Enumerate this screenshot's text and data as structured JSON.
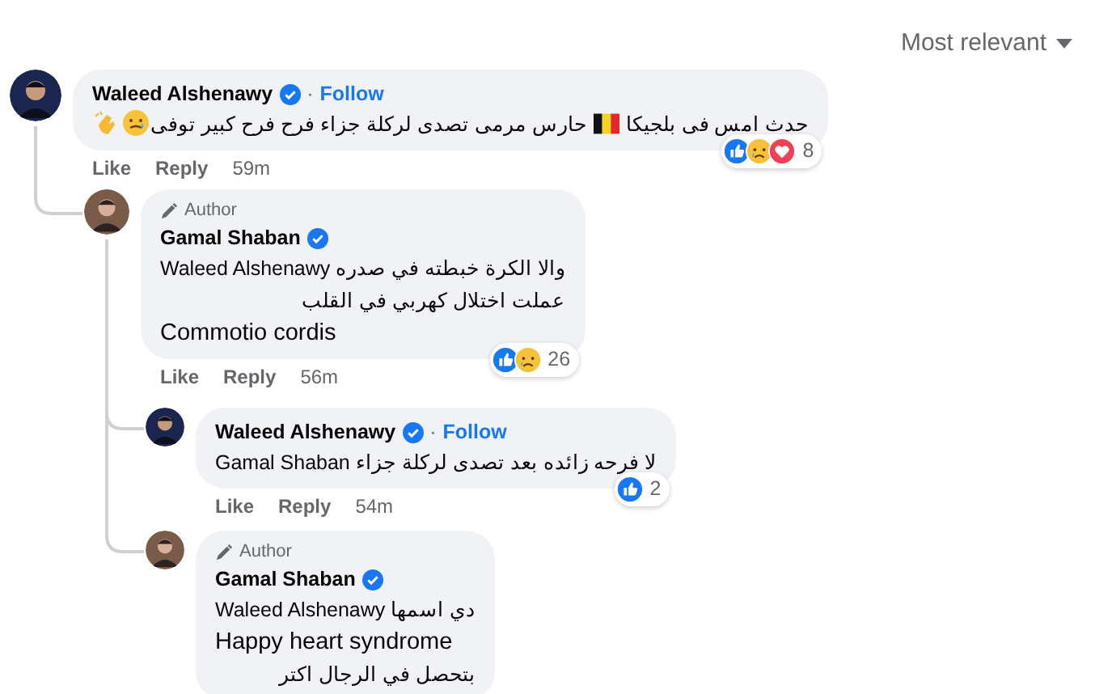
{
  "sort": {
    "label": "Most relevant"
  },
  "comments": [
    {
      "name": "Waleed Alshenawy",
      "verified": true,
      "separator": "·",
      "follow": "Follow",
      "lines": [
        [
          {
            "kind": "text",
            "text": "حدث امس فى بلجيكا"
          },
          {
            "kind": "flag-be"
          },
          {
            "kind": "text",
            "text": "حارس مرمى تصدى لركلة جزاء فرح فرح كبير توفى"
          },
          {
            "kind": "tear-smile"
          },
          {
            "kind": "clap"
          }
        ]
      ],
      "actions": [
        "Like",
        "Reply"
      ],
      "time": "59m",
      "reactions": [
        {
          "kind": "like"
        },
        {
          "kind": "sad"
        },
        {
          "kind": "love"
        }
      ],
      "reaction_count": "8",
      "children": [
        {
          "badge": "Author",
          "name": "Gamal Shaban",
          "verified": true,
          "lines": [
            [
              {
                "kind": "text",
                "text": "والا الكرة خبطته في صدره Waleed Alshenawy"
              }
            ],
            [
              {
                "kind": "text",
                "text": "عملت اختلال كهربي في القلب"
              }
            ],
            [
              {
                "kind": "text",
                "text": "Commotio cordis"
              }
            ]
          ],
          "actions": [
            "Like",
            "Reply"
          ],
          "time": "56m",
          "reactions": [
            {
              "kind": "like"
            },
            {
              "kind": "sad"
            }
          ],
          "reaction_count": "26",
          "children": [
            {
              "name": "Waleed Alshenawy",
              "verified": true,
              "separator": "·",
              "follow": "Follow",
              "lines": [
                [
                  {
                    "kind": "text",
                    "text": "لا فرحه زائده بعد تصدى لركلة جزاء Gamal Shaban"
                  }
                ]
              ],
              "actions": [
                "Like",
                "Reply"
              ],
              "time": "54m",
              "reactions": [
                {
                  "kind": "like"
                }
              ],
              "reaction_count": "2"
            },
            {
              "badge": "Author",
              "name": "Gamal Shaban",
              "verified": true,
              "lines": [
                [
                  {
                    "kind": "text",
                    "text": "دي اسمها Waleed Alshenawy"
                  }
                ],
                [
                  {
                    "kind": "text",
                    "text": "Happy heart syndrome"
                  }
                ],
                [
                  {
                    "kind": "text",
                    "text": "بتحصل في الرجال اكتر"
                  }
                ]
              ]
            }
          ]
        }
      ]
    }
  ]
}
